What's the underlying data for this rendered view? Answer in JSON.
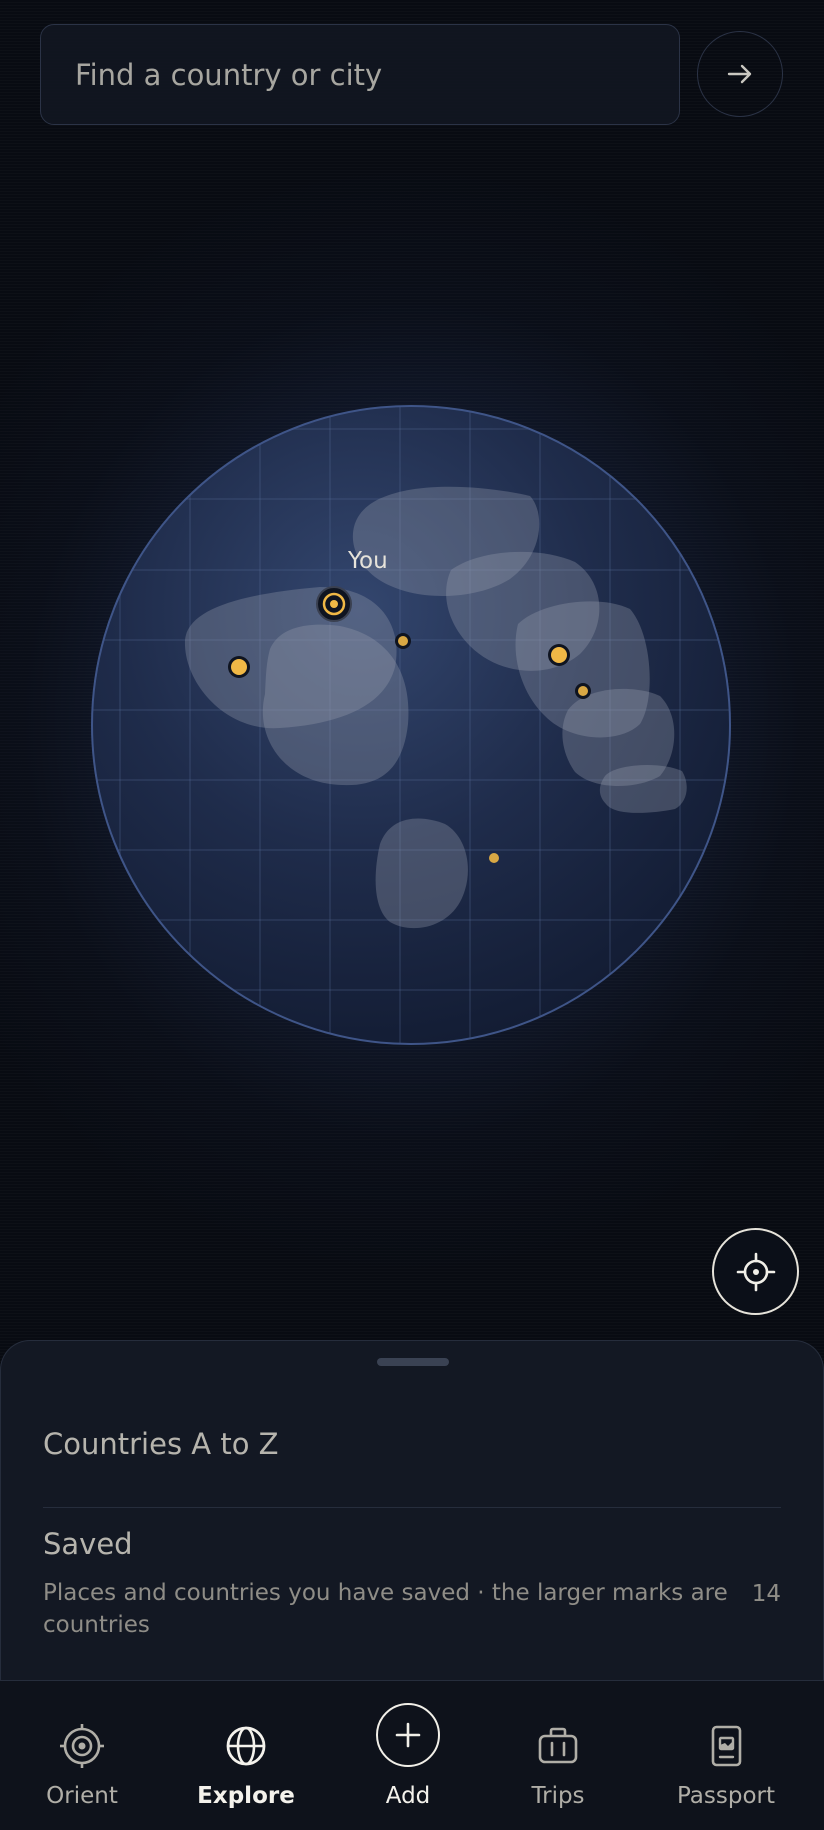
{
  "search": {
    "placeholder": "Find a country or city",
    "go_icon": "arrow-right-icon"
  },
  "map": {
    "you_label": "You",
    "locate_icon": "crosshair-icon",
    "colors": {
      "accent": "#f0b846",
      "globe_edge": "#3a5080",
      "land": "#8893a6"
    }
  },
  "sheet": {
    "title": "Countries A to Z",
    "saved": {
      "title": "Saved",
      "description": "Places and countries you have saved · the larger marks are countries",
      "count": "14"
    }
  },
  "nav": {
    "items": [
      {
        "label": "Orient",
        "icon": "target-icon",
        "active": false
      },
      {
        "label": "Explore",
        "icon": "globe-icon",
        "active": true
      },
      {
        "label": "Add",
        "icon": "plus-icon",
        "active": false
      },
      {
        "label": "Trips",
        "icon": "suitcase-icon",
        "active": false
      },
      {
        "label": "Passport",
        "icon": "passport-icon",
        "active": false
      }
    ]
  }
}
